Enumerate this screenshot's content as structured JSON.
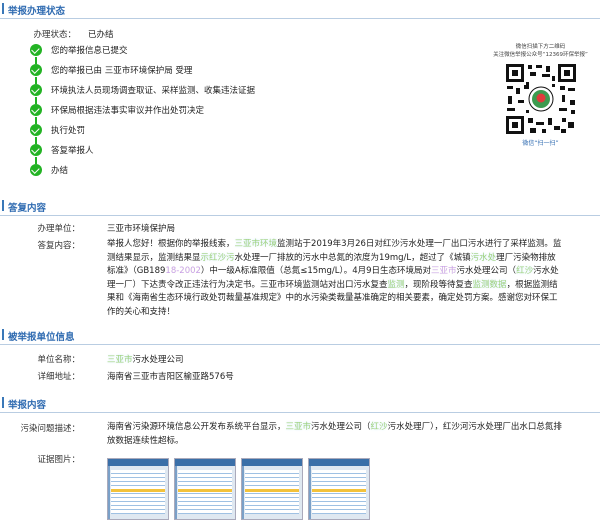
{
  "status_section": {
    "title": "举报办理状态",
    "status_label": "办理状态：",
    "status_value": "已办结",
    "steps": [
      "您的举报信息已提交",
      "您的举报已由 三亚市环境保护局 受理",
      "环境执法人员现场调查取证、采样监测、收集违法证据",
      "环保局根据违法事实审议并作出处罚决定",
      "执行处罚",
      "答复举报人",
      "办结"
    ],
    "qr": {
      "caption_line1": "微信扫描下方二维码",
      "caption_line2": "关注微信举报公众号“12369环保举报”",
      "caption_line3": "微信“扫一扫”"
    }
  },
  "reply_section": {
    "title": "答复内容",
    "unit_label": "办理单位：",
    "unit_value": "三亚市环境保护局",
    "content_label": "答复内容：",
    "content_parts": [
      "举报人您好！根据你的举报线索，",
      "三亚市环境",
      "监测站于2019年3月26日对红沙污水处理一厂出口污水进行了采样监测。监测结果显示，监测结果显",
      "示红沙污",
      "水处理一厂排放的污水中总氮的浓度为19mg/L，超过了《城镇",
      "污水处",
      "理厂污染物排放标准》（GB189",
      "18-2002",
      "）中一级A标准限值（总氮≤15mg/L）。4月9日生态环境局对",
      "三亚市",
      "污水处理公司（",
      "红沙",
      "污水处理一厂）下达责令改正违法行为决定书。三亚市环境监测站对出口污水复查",
      "监测",
      "，现阶段等待复查",
      "监测数据",
      "，根据监测结果和《海南省生态环境行政处罚裁量基准规定》中的水污染类裁量基准确定的相关要素，确定处罚方案。感谢您对环保工作的关心和支持！"
    ]
  },
  "reported_section": {
    "title": "被举报单位信息",
    "name_label": "单位名称：",
    "name_value_a": "三亚市",
    "name_value_b": "污水处理公司",
    "address_label": "详细地址：",
    "address_value": "海南省三亚市吉阳区榆亚路576号"
  },
  "report_section": {
    "title": "举报内容",
    "problem_label": "污染问题描述：",
    "problem_parts": [
      "海南省污染源环境信息公开发布系统平台显示，",
      "三亚市",
      "污水处理公司（",
      "红沙",
      "污水处理厂），红沙河污水处理厂出水口总氮排放数据连续性超标。"
    ],
    "evidence_label": "证据图片："
  },
  "colors": {
    "accent": "#2f6bb1",
    "check": "#23b324",
    "divider": "#b9cde2"
  }
}
